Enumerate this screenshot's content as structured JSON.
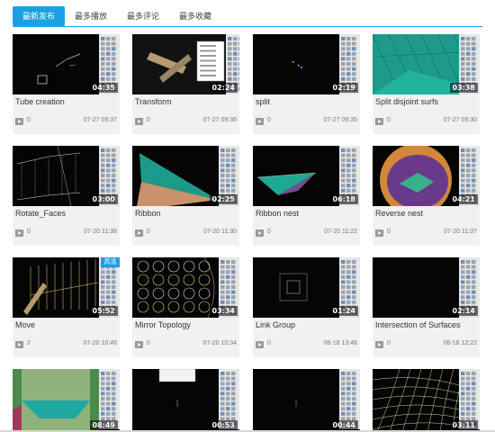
{
  "tabs": [
    {
      "label": "最新发布",
      "active": true
    },
    {
      "label": "最多播放",
      "active": false
    },
    {
      "label": "最多评论",
      "active": false
    },
    {
      "label": "最多收藏",
      "active": false
    }
  ],
  "colors": {
    "accent": "#1ba0e1",
    "card_bg": "#f1f1f1",
    "thumb_bg": "#050505"
  },
  "videos": [
    {
      "title": "Tube creation",
      "duration": "04:35",
      "views": "0",
      "date": "07-27 09:37",
      "thumb": "lines"
    },
    {
      "title": "Transform",
      "duration": "02:24",
      "views": "0",
      "date": "07-27 09:36",
      "thumb": "transform"
    },
    {
      "title": "split",
      "duration": "02:19",
      "views": "0",
      "date": "07-27 09:35",
      "thumb": "dots"
    },
    {
      "title": "Split disjoint surfs",
      "duration": "03:38",
      "views": "0",
      "date": "07-27 09:30",
      "thumb": "teal"
    },
    {
      "title": "Rotate_Faces",
      "duration": "03:00",
      "views": "0",
      "date": "07-20 11:38",
      "thumb": "wire"
    },
    {
      "title": "Ribbon",
      "duration": "02:25",
      "views": "0",
      "date": "07-20 11:30",
      "thumb": "ribbon"
    },
    {
      "title": "Ribbon nest",
      "duration": "06:18",
      "views": "0",
      "date": "07-20 11:22",
      "thumb": "ribbon-nest"
    },
    {
      "title": "Reverse nest",
      "duration": "04:21",
      "views": "0",
      "date": "07-20 11:07",
      "thumb": "reverse"
    },
    {
      "title": "Move",
      "duration": "05:52",
      "views": "2",
      "date": "07-20 10:46",
      "thumb": "move",
      "badge": "高清"
    },
    {
      "title": "Mirror Topology",
      "duration": "03:34",
      "views": "0",
      "date": "07-20 10:34",
      "thumb": "circles"
    },
    {
      "title": "Link Group",
      "duration": "01:24",
      "views": "0",
      "date": "06-18 13:48",
      "thumb": "squares"
    },
    {
      "title": "Intersection of Surfaces",
      "duration": "02:14",
      "views": "0",
      "date": "06-18 12:22",
      "thumb": "dark"
    },
    {
      "title": "",
      "duration": "08:49",
      "views": "",
      "date": "",
      "thumb": "cylinder"
    },
    {
      "title": "",
      "duration": "00:53",
      "views": "",
      "date": "",
      "thumb": "blank-dialog"
    },
    {
      "title": "",
      "duration": "00:44",
      "views": "",
      "date": "",
      "thumb": "blank"
    },
    {
      "title": "",
      "duration": "03:11",
      "views": "",
      "date": "",
      "thumb": "grid"
    }
  ]
}
